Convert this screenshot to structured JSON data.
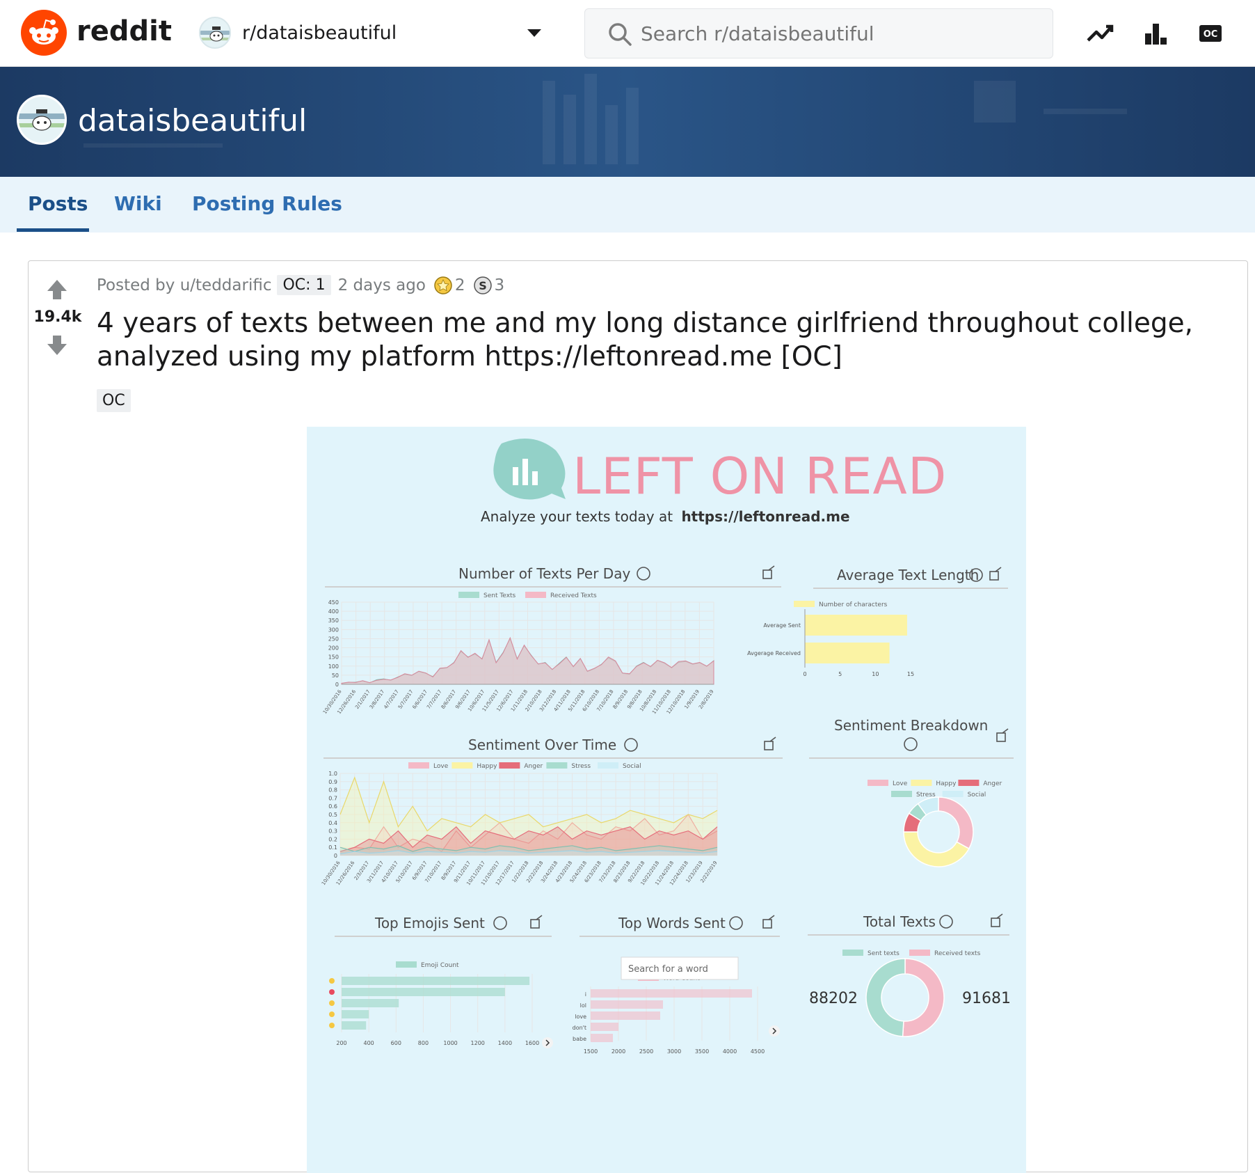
{
  "topbar": {
    "brand": "reddit",
    "subreddit": "r/dataisbeautiful",
    "search_placeholder": "Search r/dataisbeautiful"
  },
  "banner": {
    "title": "dataisbeautiful"
  },
  "tabs": [
    {
      "label": "Posts",
      "active": true
    },
    {
      "label": "Wiki"
    },
    {
      "label": "Posting Rules"
    }
  ],
  "post": {
    "score": "19.4k",
    "posted_by": "Posted by u/teddarific",
    "author_flair": "OC: 1",
    "time": "2 days ago",
    "award_1_count": "2",
    "award_2_count": "3",
    "title": "4 years of texts between me and my long distance girlfriend throughout college, analyzed using my platform https://leftonread.me [OC]",
    "flair": "OC"
  },
  "infographic": {
    "logo": "LEFT ON READ",
    "tagline": "Analyze your texts today at",
    "tagline_url": "https://leftonread.me",
    "panel_titles": {
      "texts_per_day": "Number of Texts Per Day",
      "avg_length": "Average Text Length",
      "sentiment_time": "Sentiment Over Time",
      "sentiment_breakdown": "Sentiment Breakdown",
      "top_emojis": "Top Emojis Sent",
      "top_words": "Top Words Sent",
      "total_texts": "Total Texts"
    },
    "word_search_placeholder": "Search for a word",
    "legend": {
      "sent": "Sent Texts",
      "received": "Received Texts",
      "chars": "Number of characters",
      "love": "Love",
      "happy": "Happy",
      "anger": "Anger",
      "stress": "Stress",
      "social": "Social",
      "emoji": "Emoji Count",
      "word": "Word Count",
      "sent_small": "Sent texts",
      "received_small": "Received texts"
    },
    "avg_length_labels": [
      "Average Sent",
      "Avgerage Received"
    ],
    "avg_length_ticks": [
      "0",
      "5",
      "10",
      "15"
    ],
    "words": [
      "i",
      "lol",
      "love",
      "don't",
      "babe"
    ],
    "emoji_ticks": [
      "200",
      "400",
      "600",
      "800",
      "1000",
      "1200",
      "1400",
      "1600"
    ],
    "word_ticks": [
      "1500",
      "2000",
      "2500",
      "3000",
      "3500",
      "4000",
      "4500"
    ],
    "tpd_yticks": [
      "450",
      "400",
      "350",
      "300",
      "250",
      "200",
      "150",
      "100",
      "50",
      "0"
    ],
    "sot_yticks": [
      "1.0",
      "0.9",
      "0.8",
      "0.7",
      "0.6",
      "0.5",
      "0.4",
      "0.3",
      "0.2",
      "0.1",
      "0"
    ],
    "tpd_xticks": [
      "10/30/2016",
      "12/26/2016",
      "2/1/2017",
      "3/8/2017",
      "4/7/2017",
      "5/7/2017",
      "6/6/2017",
      "7/7/2017",
      "8/6/2017",
      "9/6/2017",
      "10/6/2017",
      "11/5/2017",
      "12/6/2017",
      "1/11/2018",
      "2/10/2018",
      "3/12/2018",
      "4/11/2018",
      "5/11/2018",
      "6/10/2018",
      "7/10/2018",
      "8/9/2018",
      "9/8/2018",
      "10/8/2018",
      "11/10/2018",
      "12/10/2018",
      "1/9/2019",
      "2/8/2019"
    ],
    "sot_xticks": [
      "10/30/2016",
      "12/26/2016",
      "2/3/2017",
      "3/11/2017",
      "4/10/2017",
      "5/10/2017",
      "6/9/2017",
      "7/10/2017",
      "8/9/2017",
      "9/11/2017",
      "10/11/2017",
      "11/10/2017",
      "12/17/2017",
      "1/22/2018",
      "2/22/2018",
      "3/24/2018",
      "4/23/2018",
      "5/24/2018",
      "6/23/2018",
      "7/23/2018",
      "8/23/2018",
      "9/22/2018",
      "10/22/2018",
      "11/24/2018",
      "12/24/2018",
      "1/23/2019",
      "2/22/2019"
    ],
    "total_sent": "88202",
    "total_received": "91681",
    "chart_data": [
      {
        "type": "area",
        "title": "Number of Texts Per Day",
        "ylim": [
          0,
          450
        ],
        "series": [
          {
            "name": "Sent Texts",
            "values": [
              5,
              10,
              12,
              18,
              8,
              25,
              30,
              22,
              40,
              55,
              48,
              70,
              60,
              42,
              85,
              90,
              120,
              180,
              150,
              165,
              140,
              240,
              120,
              175,
              250,
              140,
              210,
              160,
              110,
              120,
              80,
              115,
              150,
              95,
              140,
              70,
              85,
              110,
              145,
              125,
              60,
              55,
              100,
              120,
              95,
              130,
              115,
              90,
              120,
              125,
              110,
              118,
              98,
              130
            ]
          },
          {
            "name": "Received Texts",
            "values": [
              6,
              12,
              10,
              20,
              9,
              22,
              28,
              24,
              38,
              58,
              50,
              72,
              62,
              40,
              88,
              92,
              118,
              185,
              148,
              170,
              138,
              245,
              118,
              172,
              255,
              138,
              215,
              158,
              112,
              118,
              82,
              112,
              148,
              98,
              142,
              72,
              88,
              108,
              150,
              128,
              62,
              58,
              98,
              118,
              98,
              132,
              118,
              92,
              125,
              128,
              112,
              120,
              100,
              128
            ]
          }
        ]
      },
      {
        "type": "bar",
        "title": "Average Text Length",
        "categories": [
          "Average Sent",
          "Avgerage Received"
        ],
        "series": [
          {
            "name": "Number of characters",
            "values": [
              14.5,
              12
            ]
          }
        ],
        "xlim": [
          0,
          15
        ]
      },
      {
        "type": "line",
        "title": "Sentiment Over Time",
        "ylim": [
          0,
          1.0
        ],
        "series": [
          {
            "name": "Love",
            "values": [
              0.05,
              0.1,
              0.08,
              0.35,
              0.1,
              0.2,
              0.15,
              0.05,
              0.3,
              0.1,
              0.25,
              0.4,
              0.2,
              0.15,
              0.3,
              0.2,
              0.4,
              0.25,
              0.2,
              0.35,
              0.3,
              0.45,
              0.25,
              0.3,
              0.5,
              0.2,
              0.3
            ]
          },
          {
            "name": "Happy",
            "values": [
              0.5,
              0.95,
              0.4,
              0.9,
              0.35,
              0.6,
              0.3,
              0.45,
              0.4,
              0.35,
              0.5,
              0.4,
              0.45,
              0.5,
              0.35,
              0.4,
              0.45,
              0.5,
              0.4,
              0.45,
              0.55,
              0.5,
              0.45,
              0.4,
              0.5,
              0.45,
              0.55
            ]
          },
          {
            "name": "Anger",
            "values": [
              0.05,
              0.1,
              0.2,
              0.15,
              0.3,
              0.1,
              0.25,
              0.2,
              0.35,
              0.15,
              0.3,
              0.25,
              0.2,
              0.3,
              0.25,
              0.35,
              0.2,
              0.3,
              0.25,
              0.3,
              0.35,
              0.2,
              0.3,
              0.25,
              0.3,
              0.2,
              0.35
            ]
          },
          {
            "name": "Stress",
            "values": [
              0.1,
              0.05,
              0.1,
              0.08,
              0.12,
              0.05,
              0.1,
              0.08,
              0.06,
              0.1,
              0.08,
              0.12,
              0.1,
              0.06,
              0.08,
              0.1,
              0.12,
              0.08,
              0.1,
              0.06,
              0.08,
              0.1,
              0.12,
              0.1,
              0.08,
              0.06,
              0.1
            ]
          },
          {
            "name": "Social",
            "values": [
              0.02,
              0.05,
              0.03,
              0.04,
              0.06,
              0.03,
              0.05,
              0.04,
              0.03,
              0.05,
              0.04,
              0.06,
              0.05,
              0.03,
              0.04,
              0.05,
              0.06,
              0.04,
              0.05,
              0.03,
              0.04,
              0.05,
              0.06,
              0.05,
              0.04,
              0.03,
              0.05
            ]
          }
        ]
      },
      {
        "type": "pie",
        "title": "Sentiment Breakdown",
        "categories": [
          "Love",
          "Happy",
          "Anger",
          "Stress",
          "Social"
        ],
        "values": [
          33,
          42,
          9,
          6,
          10
        ]
      },
      {
        "type": "bar",
        "title": "Top Emojis Sent",
        "series": [
          {
            "name": "Emoji Count",
            "values": [
              1580,
              1400,
              620,
              400,
              380
            ]
          }
        ],
        "xlim": [
          200,
          1600
        ]
      },
      {
        "type": "bar",
        "title": "Top Words Sent",
        "categories": [
          "i",
          "lol",
          "love",
          "don't",
          "babe"
        ],
        "series": [
          {
            "name": "Word Count",
            "values": [
              4400,
              2800,
              2750,
              2000,
              1900
            ]
          }
        ],
        "xlim": [
          1500,
          4500
        ]
      },
      {
        "type": "pie",
        "title": "Total Texts",
        "categories": [
          "Sent texts",
          "Received texts"
        ],
        "values": [
          88202,
          91681
        ]
      }
    ]
  },
  "colors": {
    "reddit_orange": "#ff4500",
    "banner": "#1f3f66",
    "tabs_bg": "#e9f4fb",
    "tab_text": "#2e6db1",
    "infographic_bg": "#e1f4fb",
    "logo_teal": "#93d1c8",
    "logo_pink": "#ef93a6",
    "sent": "#a8dccf",
    "received": "#f4b9c6",
    "love": "#f4b9c6",
    "happy": "#fbf3a4",
    "anger": "#e56d7a",
    "stress": "#a8dccf",
    "social": "#cfeef7"
  }
}
